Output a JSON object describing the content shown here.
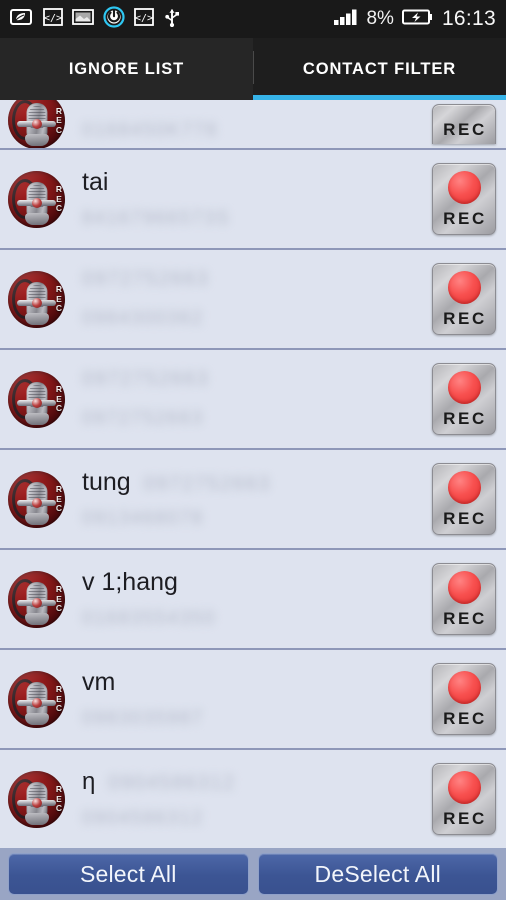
{
  "status_bar": {
    "icons": [
      "leaf-battery-saver-icon",
      "code-brackets-icon",
      "screenshot-icon",
      "power-icon",
      "code-brackets-icon",
      "usb-icon"
    ],
    "signal": "signal-bars-icon",
    "battery_percent": "8%",
    "battery": "battery-charging-icon",
    "clock": "16:13",
    "accent": "#36b3e8"
  },
  "tabs": {
    "items": [
      {
        "label": "IGNORE LIST",
        "active": false
      },
      {
        "label": "CONTACT FILTER",
        "active": true
      }
    ],
    "active_index": 1,
    "underline_color": "#36b3e8"
  },
  "list": {
    "rows": [
      {
        "partial": true,
        "name": "",
        "name_blurred": "",
        "number_blurred": "0168450K778",
        "rec_label": "REC"
      },
      {
        "partial": false,
        "name": "tai",
        "name_blurred": "",
        "number_blurred": "84167966573S",
        "rec_label": "REC"
      },
      {
        "partial": false,
        "name": "",
        "name_blurred": "0972752663",
        "number_blurred": "0984300362",
        "rec_label": "REC"
      },
      {
        "partial": false,
        "name": "",
        "name_blurred": "0972752663",
        "number_blurred": "0972752663",
        "rec_label": "REC"
      },
      {
        "partial": false,
        "name": "tung",
        "name_blurred": "0972752663",
        "number_blurred": "0913468078",
        "rec_label": "REC"
      },
      {
        "partial": false,
        "name": "v 1;hang",
        "name_blurred": "",
        "number_blurred": "01683554350",
        "rec_label": "REC"
      },
      {
        "partial": false,
        "name": "vm",
        "name_blurred": "",
        "number_blurred": "0983035987",
        "rec_label": "REC"
      },
      {
        "partial": false,
        "name": "η",
        "name_blurred": "0904586312",
        "number_blurred": "0904586312",
        "rec_label": "REC"
      }
    ],
    "avatar_rec_text": "REC",
    "row_background": "#dee3ef",
    "separator_color": "#8e97b8"
  },
  "bottom_bar": {
    "select_all": "Select All",
    "deselect_all": "DeSelect All",
    "background": "#99a5c4",
    "button_color": "#3c5594"
  }
}
